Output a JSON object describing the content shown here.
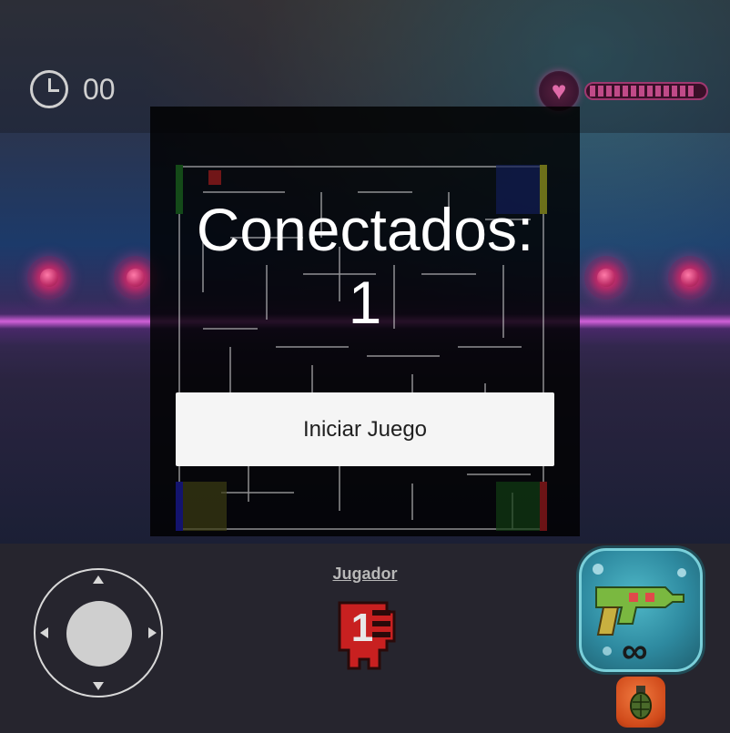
{
  "hud": {
    "timer_icon": "clock-icon",
    "timer_value": "00",
    "health_icon": "heart-icon",
    "health_level": 1.0
  },
  "overlay": {
    "title": "Conectados:\n1",
    "start_button_label": "Iniciar Juego"
  },
  "controls": {
    "joystick_icon": "joystick",
    "player_label": "Jugador",
    "player_number": "1",
    "weapon_icon": "ray-gun-icon",
    "ammo": "∞",
    "grenade_icon": "grenade-icon"
  },
  "colors": {
    "overlay_bg": "#000000",
    "button_bg": "#f5f5f5",
    "accent_pink": "#d060d8",
    "player_red": "#c82020",
    "weapon_teal": "#4fb8c8"
  }
}
